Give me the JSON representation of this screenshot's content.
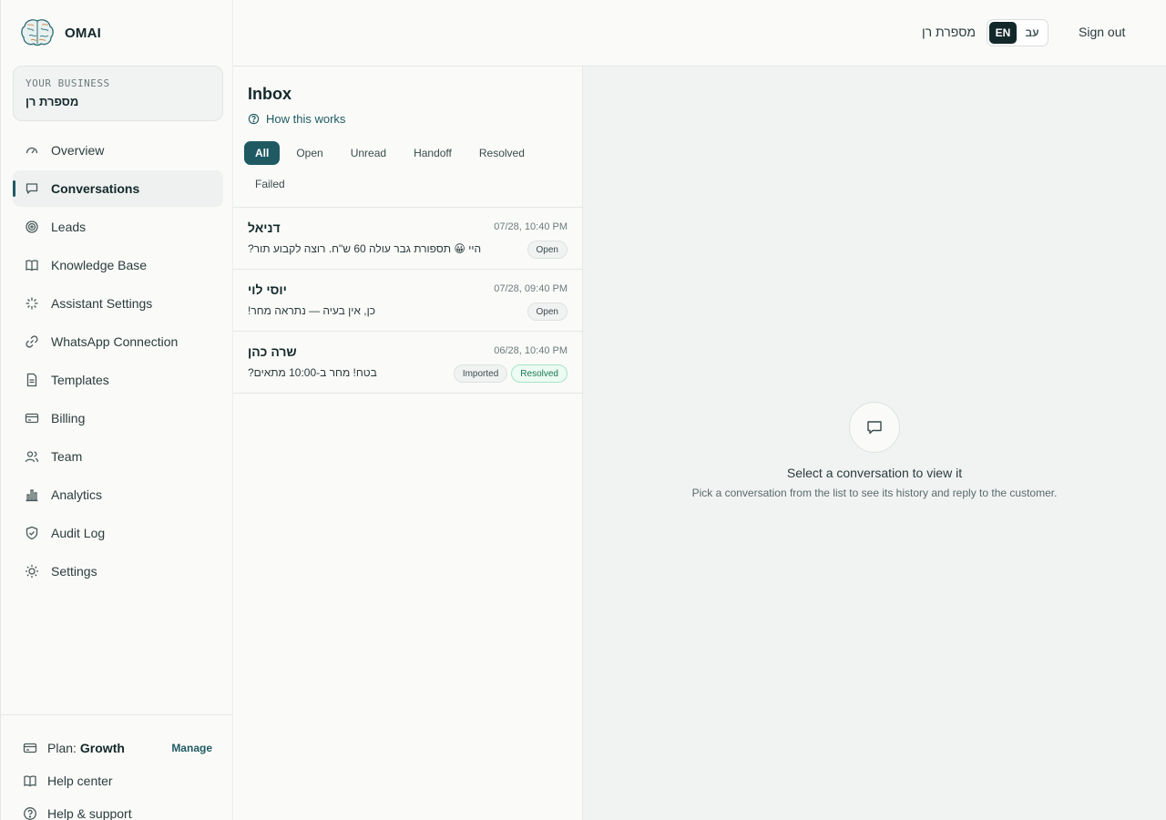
{
  "app": {
    "name": "OMAI"
  },
  "business": {
    "label": "YOUR BUSINESS",
    "name": "מספרת רן"
  },
  "nav": {
    "items": [
      {
        "label": "Overview",
        "icon": "gauge-icon"
      },
      {
        "label": "Conversations",
        "icon": "chat-bubble-icon",
        "active": true
      },
      {
        "label": "Leads",
        "icon": "target-icon"
      },
      {
        "label": "Knowledge Base",
        "icon": "book-icon"
      },
      {
        "label": "Assistant Settings",
        "icon": "sparkle-icon"
      },
      {
        "label": "WhatsApp Connection",
        "icon": "link-icon"
      },
      {
        "label": "Templates",
        "icon": "document-icon"
      },
      {
        "label": "Billing",
        "icon": "credit-card-icon"
      },
      {
        "label": "Team",
        "icon": "users-icon"
      },
      {
        "label": "Analytics",
        "icon": "bar-chart-icon"
      },
      {
        "label": "Audit Log",
        "icon": "shield-icon"
      },
      {
        "label": "Settings",
        "icon": "sun-gear-icon"
      }
    ]
  },
  "footer": {
    "plan_label": "Plan:",
    "plan_value": "Growth",
    "manage_label": "Manage",
    "help_center": "Help center",
    "help_support": "Help & support"
  },
  "topbar": {
    "business_name": "מספרת רן",
    "lang_en": "EN",
    "lang_he": "עב",
    "sign_out": "Sign out"
  },
  "inbox": {
    "title": "Inbox",
    "how_link": "How this works",
    "filters": [
      "All",
      "Open",
      "Unread",
      "Handoff",
      "Resolved",
      "Failed"
    ],
    "conversations": [
      {
        "name": "דניאל",
        "time": "07/28, 10:40 PM",
        "preview": "היי 😀 תספורת גבר עולה 60 ש\"ח. רוצה לקבוע תור?",
        "badges": [
          {
            "label": "Open",
            "kind": "default"
          }
        ]
      },
      {
        "name": "יוסי לוי",
        "time": "07/28, 09:40 PM",
        "preview": "כן, אין בעיה — נתראה מחר!",
        "badges": [
          {
            "label": "Open",
            "kind": "default"
          }
        ]
      },
      {
        "name": "שרה כהן",
        "time": "06/28, 10:40 PM",
        "preview": "בטח! מחר ב-10:00 מתאים?",
        "badges": [
          {
            "label": "Imported",
            "kind": "default"
          },
          {
            "label": "Resolved",
            "kind": "resolved"
          }
        ]
      }
    ]
  },
  "detail": {
    "empty_title": "Select a conversation to view it",
    "empty_subtitle": "Pick a conversation from the list to see its history and reply to the customer."
  }
}
